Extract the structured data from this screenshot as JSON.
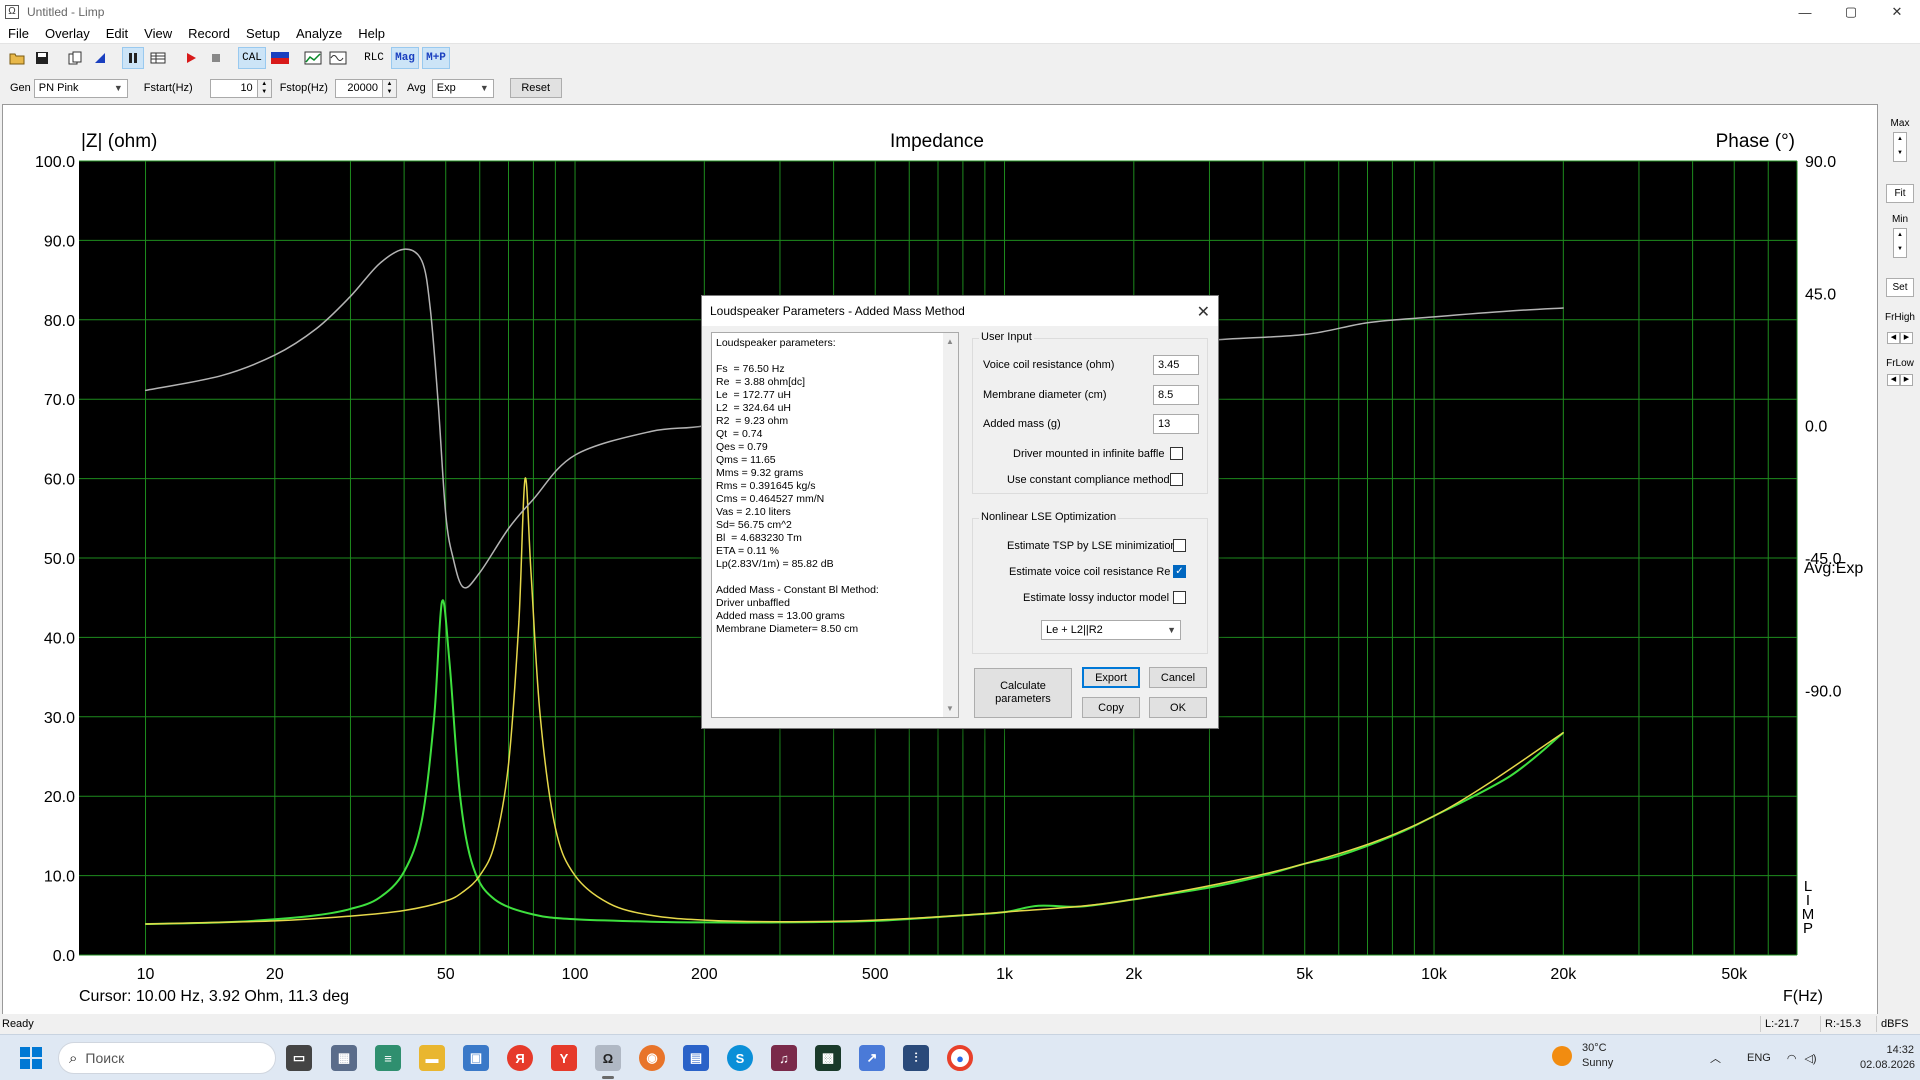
{
  "window": {
    "title": "Untitled - Limp",
    "icon": "Ω",
    "controls": [
      "—",
      "▢",
      "✕"
    ]
  },
  "menu": [
    "File",
    "Overlay",
    "Edit",
    "View",
    "Record",
    "Setup",
    "Analyze",
    "Help"
  ],
  "toolbar": {
    "cal_label": "CAL",
    "rlc_label": "RLC",
    "mag_label": "Mag",
    "mp_label": "M+P"
  },
  "genbar": {
    "gen_label": "Gen",
    "gen_value": "PN Pink",
    "fstart_label": "Fstart(Hz)",
    "fstart_value": "10",
    "fstop_label": "Fstop(Hz)",
    "fstop_value": "20000",
    "avg_label": "Avg",
    "avg_value": "Exp",
    "reset_label": "Reset"
  },
  "plot": {
    "title": "Impedance",
    "left_axis_title": "|Z| (ohm)",
    "right_axis_title": "Phase (°)",
    "x_axis_title": "F(Hz)",
    "avg_label": "Avg:Exp",
    "limp_label": [
      "L",
      "I",
      "M",
      "P"
    ],
    "cursor_text": "Cursor: 10.00 Hz, 3.92 Ohm, 11.3 deg",
    "colors": {
      "background": "#000000",
      "grid": "#1e8c1e",
      "impedance_green": "#3ee03e",
      "impedance_yellow": "#e6d84a",
      "phase": "#b4b4b4"
    }
  },
  "chart_data": {
    "type": "line",
    "title": "Impedance",
    "xlabel": "F(Hz)",
    "ylabel": "|Z| (ohm)",
    "y2label": "Phase (°)",
    "xscale": "log",
    "xlim": [
      7,
      70000
    ],
    "ylim": [
      0,
      100
    ],
    "y2lim": [
      -180,
      90
    ],
    "x_ticks": [
      {
        "v": 10,
        "label": "10"
      },
      {
        "v": 20,
        "label": "20"
      },
      {
        "v": 50,
        "label": "50"
      },
      {
        "v": 100,
        "label": "100"
      },
      {
        "v": 200,
        "label": "200"
      },
      {
        "v": 500,
        "label": "500"
      },
      {
        "v": 1000,
        "label": "1k"
      },
      {
        "v": 2000,
        "label": "2k"
      },
      {
        "v": 5000,
        "label": "5k"
      },
      {
        "v": 10000,
        "label": "10k"
      },
      {
        "v": 20000,
        "label": "20k"
      },
      {
        "v": 50000,
        "label": "50k"
      }
    ],
    "y_ticks": [
      "0.0",
      "10.0",
      "20.0",
      "30.0",
      "40.0",
      "50.0",
      "60.0",
      "70.0",
      "80.0",
      "90.0",
      "100.0"
    ],
    "y2_ticks": [
      {
        "v": 90,
        "label": "90.0"
      },
      {
        "v": 45,
        "label": "45.0"
      },
      {
        "v": 0,
        "label": "0.0"
      },
      {
        "v": -45,
        "label": "-45.0"
      },
      {
        "v": -90,
        "label": "-90.0"
      }
    ],
    "grid": true,
    "series": [
      {
        "color": "#3ee03e",
        "axis": "left",
        "points": [
          [
            10,
            3.9
          ],
          [
            15,
            4.1
          ],
          [
            20,
            4.5
          ],
          [
            25,
            5.0
          ],
          [
            30,
            5.8
          ],
          [
            35,
            7.2
          ],
          [
            40,
            10.5
          ],
          [
            44,
            17
          ],
          [
            47,
            30
          ],
          [
            49,
            44.5
          ],
          [
            51,
            37
          ],
          [
            54,
            20
          ],
          [
            58,
            11
          ],
          [
            65,
            7
          ],
          [
            80,
            5.1
          ],
          [
            100,
            4.5
          ],
          [
            150,
            4.2
          ],
          [
            200,
            4.1
          ],
          [
            300,
            4.1
          ],
          [
            500,
            4.3
          ],
          [
            800,
            5.0
          ],
          [
            1000,
            5.4
          ],
          [
            1200,
            6.2
          ],
          [
            1500,
            6.1
          ],
          [
            2000,
            7.0
          ],
          [
            3000,
            8.5
          ],
          [
            4000,
            10.0
          ],
          [
            5000,
            11.5
          ],
          [
            6000,
            12.5
          ],
          [
            8000,
            15.0
          ],
          [
            10000,
            17.5
          ],
          [
            15000,
            22.5
          ],
          [
            20000,
            28.0
          ]
        ]
      },
      {
        "color": "#e6d84a",
        "axis": "left",
        "points": [
          [
            10,
            3.9
          ],
          [
            20,
            4.3
          ],
          [
            30,
            4.9
          ],
          [
            40,
            5.6
          ],
          [
            50,
            6.8
          ],
          [
            55,
            8.0
          ],
          [
            60,
            10.0
          ],
          [
            65,
            14.0
          ],
          [
            70,
            24.0
          ],
          [
            74,
            42.0
          ],
          [
            76.5,
            60.0
          ],
          [
            79,
            48.0
          ],
          [
            83,
            30.0
          ],
          [
            90,
            16.0
          ],
          [
            100,
            10.0
          ],
          [
            120,
            6.5
          ],
          [
            150,
            5.0
          ],
          [
            200,
            4.4
          ],
          [
            300,
            4.2
          ],
          [
            500,
            4.4
          ],
          [
            1000,
            5.4
          ],
          [
            2000,
            7.0
          ],
          [
            5000,
            11.5
          ],
          [
            10000,
            17.5
          ],
          [
            20000,
            28.0
          ]
        ]
      },
      {
        "color": "#b4b4b4",
        "axis": "right",
        "points": [
          [
            10,
            12
          ],
          [
            15,
            17
          ],
          [
            20,
            24
          ],
          [
            25,
            33
          ],
          [
            30,
            44
          ],
          [
            35,
            55
          ],
          [
            40,
            60
          ],
          [
            44,
            56
          ],
          [
            46,
            40
          ],
          [
            48,
            8
          ],
          [
            50,
            -30
          ],
          [
            52,
            -45
          ],
          [
            55,
            -55
          ],
          [
            60,
            -50
          ],
          [
            70,
            -35
          ],
          [
            80,
            -25
          ],
          [
            100,
            -10
          ],
          [
            150,
            -2
          ],
          [
            200,
            0
          ],
          [
            300,
            6
          ],
          [
            500,
            12
          ],
          [
            700,
            16
          ],
          [
            900,
            18
          ],
          [
            1100,
            20
          ],
          [
            1300,
            19
          ],
          [
            1600,
            22
          ],
          [
            2000,
            26
          ],
          [
            3000,
            29
          ],
          [
            5000,
            31
          ],
          [
            7000,
            35
          ],
          [
            10000,
            37
          ],
          [
            15000,
            39
          ],
          [
            20000,
            40
          ]
        ]
      }
    ]
  },
  "right_panel": {
    "max_label": "Max",
    "fit_label": "Fit",
    "min_label": "Min",
    "set_label": "Set",
    "frhigh_label": "FrHigh",
    "frlow_label": "FrLow"
  },
  "status": {
    "ready": "Ready",
    "l_value": "L:-21.7",
    "r_value": "R:-15.3",
    "unit": "dBFS"
  },
  "dialog": {
    "title": "Loudspeaker Parameters - Added Mass Method",
    "results_text": "Loudspeaker parameters:\n\nFs  = 76.50 Hz\nRe  = 3.88 ohm[dc]\nLe  = 172.77 uH\nL2  = 324.64 uH\nR2  = 9.23 ohm\nQt  = 0.74\nQes = 0.79\nQms = 11.65\nMms = 9.32 grams\nRms = 0.391645 kg/s\nCms = 0.464527 mm/N\nVas = 2.10 liters\nSd= 56.75 cm^2\nBl  = 4.683230 Tm\nETA = 0.11 %\nLp(2.83V/1m) = 85.82 dB\n\nAdded Mass - Constant Bl Method:\nDriver unbaffled\nAdded mass = 13.00 grams\nMembrane Diameter= 8.50 cm",
    "user_input_title": "User Input",
    "vc_label": "Voice coil resistance (ohm)",
    "vc_value": "3.45",
    "md_label": "Membrane diameter (cm)",
    "md_value": "8.5",
    "am_label": "Added mass (g)",
    "am_value": "13",
    "infinite_baffle_label": "Driver mounted in infinite baffle",
    "infinite_baffle_checked": false,
    "constant_compliance_label": "Use constant compliance method",
    "constant_compliance_checked": false,
    "nonlinear_title": "Nonlinear LSE Optimization",
    "estimate_tsp_label": "Estimate TSP by LSE minimization",
    "estimate_tsp_checked": false,
    "estimate_re_label": "Estimate voice coil resistance Re",
    "estimate_re_checked": true,
    "estimate_lossy_label": "Estimate lossy inductor model",
    "estimate_lossy_checked": false,
    "model_value": "Le + L2||R2",
    "calc_label": "Calculate parameters",
    "export_label": "Export",
    "cancel_label": "Cancel",
    "copy_label": "Copy",
    "ok_label": "OK"
  },
  "taskbar": {
    "search_placeholder": "Поиск",
    "weather_temp": "30°C",
    "weather_desc": "Sunny",
    "lang": "ENG",
    "time": "14:32",
    "date": "02.08.2026"
  }
}
